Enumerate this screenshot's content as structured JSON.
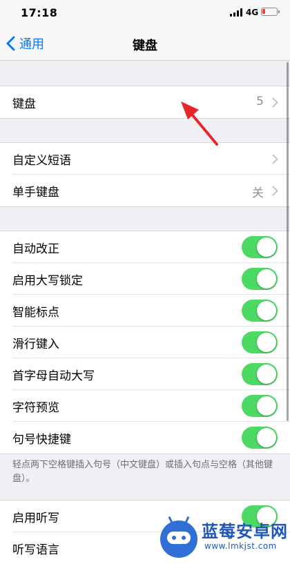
{
  "status_bar": {
    "time": "17:18",
    "network": "4G"
  },
  "nav": {
    "back_label": "通用",
    "title": "键盘"
  },
  "groups": {
    "keyboards": {
      "label": "键盘",
      "value": "5"
    },
    "text": [
      {
        "label": "自定义短语",
        "value": ""
      },
      {
        "label": "单手键盘",
        "value": "关"
      }
    ],
    "toggles": [
      {
        "label": "自动改正",
        "on": true
      },
      {
        "label": "启用大写锁定",
        "on": true
      },
      {
        "label": "智能标点",
        "on": true
      },
      {
        "label": "滑行键入",
        "on": true
      },
      {
        "label": "首字母自动大写",
        "on": true
      },
      {
        "label": "字符预览",
        "on": true
      },
      {
        "label": "句号快捷键",
        "on": true
      }
    ],
    "footnote": "轻点两下空格键插入句号（中文键盘）或插入句点与空格（其他键盘）。",
    "dictation": [
      {
        "label": "启用听写",
        "on": true
      },
      {
        "label": "听写语言"
      }
    ]
  },
  "watermark": {
    "title": "蓝莓安卓网",
    "url": "www.lmkjst.com"
  },
  "colors": {
    "accent": "#007aff",
    "toggle_on": "#4cd964",
    "annotation": "#e8262a"
  }
}
